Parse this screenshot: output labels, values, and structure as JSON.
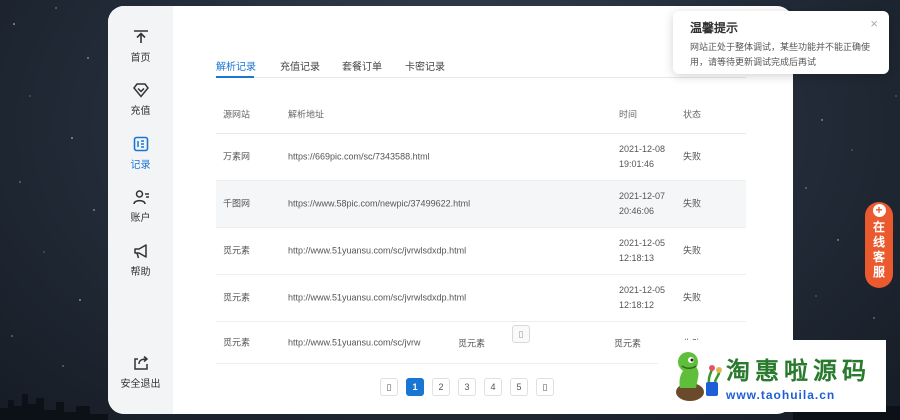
{
  "sidebar": {
    "items": [
      {
        "label": "首页",
        "icon": "home-icon"
      },
      {
        "label": "充值",
        "icon": "diamond-icon"
      },
      {
        "label": "记录",
        "icon": "record-icon"
      },
      {
        "label": "账户",
        "icon": "user-icon"
      },
      {
        "label": "帮助",
        "icon": "megaphone-icon"
      }
    ],
    "active_item": "记录",
    "logout_label": "安全退出"
  },
  "tabs": [
    {
      "label": "解析记录"
    },
    {
      "label": "充值记录"
    },
    {
      "label": "套餐订单"
    },
    {
      "label": "卡密记录"
    }
  ],
  "active_tab": "解析记录",
  "table": {
    "headers": [
      "源网站",
      "解析地址",
      "时间",
      "状态"
    ],
    "rows": [
      {
        "site": "万素网",
        "url": "https://669pic.com/sc/7343588.html",
        "date": "2021-12-08",
        "time": "19:01:46",
        "status": "失败"
      },
      {
        "site": "千图网",
        "url": "https://www.58pic.com/newpic/37499622.html",
        "date": "2021-12-07",
        "time": "20:46:06",
        "status": "失败"
      },
      {
        "site": "觅元素",
        "url": "http://www.51yuansu.com/sc/jvrwlsdxdp.html",
        "date": "2021-12-05",
        "time": "12:18:13",
        "status": "失败"
      },
      {
        "site": "觅元素",
        "url": "http://www.51yuansu.com/sc/jvrwlsdxdp.html",
        "date": "2021-12-05",
        "time": "12:18:12",
        "status": "失败"
      }
    ],
    "last_row": {
      "site": "觅元素",
      "url": "http://www.51yuansu.com/sc/jvrw",
      "overlay_site_a": "觅元素",
      "overlay_site_b": "觅元素",
      "overlay_status": "失败",
      "icon_glyph": "▯"
    }
  },
  "pagination": {
    "prev_glyph": "▯",
    "pages": [
      "1",
      "2",
      "3",
      "4",
      "5"
    ],
    "current": "1",
    "next_glyph": "▯"
  },
  "notice": {
    "title": "温馨提示",
    "body": "网站正处于整体调试，某些功能并不能正确使用，请等待更新调试完成后再试",
    "close_glyph": "×"
  },
  "service_button": {
    "label": "在线客服",
    "plus_glyph": "+"
  },
  "watermark": {
    "text": "淘惠啦源码",
    "url": "www.taohuila.cn"
  },
  "colors": {
    "accent": "#1976d2",
    "service": "#ea5a2e",
    "sidebar_bg": "#f3f4f6"
  }
}
